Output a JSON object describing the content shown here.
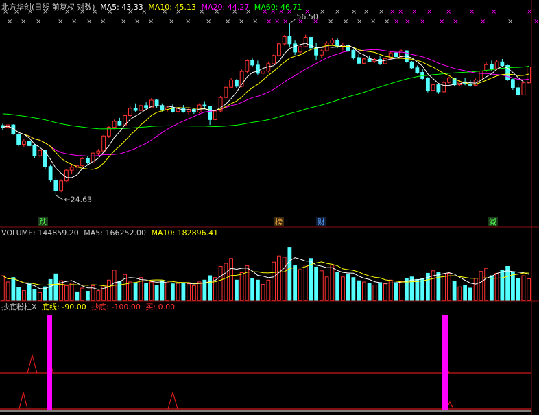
{
  "price_header": {
    "title": "北方华创(日线 前复权 对数)",
    "ma5": "MA5: 43.33",
    "ma10": "MA10: 45.13",
    "ma20": "MA20: 44.27",
    "ma60": "MA60: 46.71"
  },
  "volume_header": {
    "volume": "VOLUME: 144859.20",
    "ma5": "MA5: 166252.00",
    "ma10": "MA10: 182896.41"
  },
  "indicator_header": {
    "name": "抄底粉柱X",
    "bottom_line": "底线: -90.00",
    "chaodi": "抄底: -100.00",
    "buy": "买: 0.00"
  },
  "markers": {
    "low_label": "24.63",
    "high_label": "56.50",
    "tag_die": "跌",
    "tag_bang": "榜",
    "tag_cai": "财",
    "tag_jian": "減"
  },
  "colors": {
    "up": "#ff3232",
    "down": "#54ffff",
    "ma5": "#ffffff",
    "ma10": "#ffff00",
    "ma20": "#ff00ff",
    "ma60": "#00ff00",
    "pink_bar": "#ff00ff",
    "indicator_line": "#ff2020"
  },
  "chart_data": {
    "type": "candlestick",
    "ylim_log": [
      22.5,
      60
    ],
    "low_value": 24.63,
    "high_value": 56.5,
    "candles": [
      [
        34.5,
        34.8,
        33.8,
        34.2
      ],
      [
        34.2,
        34.9,
        33.9,
        34.6
      ],
      [
        34.6,
        34.7,
        33.0,
        33.1
      ],
      [
        33.1,
        33.5,
        31.2,
        31.5
      ],
      [
        31.5,
        32.3,
        31.1,
        32.0
      ],
      [
        32.0,
        32.4,
        31.0,
        31.3
      ],
      [
        31.3,
        31.6,
        29.5,
        29.8
      ],
      [
        29.8,
        30.8,
        29.6,
        30.6
      ],
      [
        30.6,
        30.7,
        28.0,
        28.3
      ],
      [
        28.3,
        28.6,
        26.2,
        26.5
      ],
      [
        26.5,
        26.9,
        24.63,
        25.2
      ],
      [
        25.2,
        26.6,
        25.0,
        26.4
      ],
      [
        26.4,
        28.0,
        26.2,
        27.8
      ],
      [
        27.8,
        28.5,
        27.3,
        28.2
      ],
      [
        28.2,
        28.6,
        27.7,
        28.4
      ],
      [
        28.4,
        29.6,
        28.2,
        29.4
      ],
      [
        29.4,
        29.8,
        28.5,
        28.8
      ],
      [
        28.8,
        30.5,
        28.6,
        30.2
      ],
      [
        30.2,
        30.8,
        29.9,
        30.5
      ],
      [
        30.5,
        33.0,
        30.3,
        32.8
      ],
      [
        32.8,
        34.5,
        32.5,
        34.2
      ],
      [
        34.2,
        35.5,
        33.9,
        35.2
      ],
      [
        35.2,
        35.8,
        34.4,
        34.6
      ],
      [
        34.6,
        36.4,
        34.5,
        36.2
      ],
      [
        36.2,
        37.8,
        36.0,
        37.5
      ],
      [
        37.5,
        38.4,
        36.8,
        37.1
      ],
      [
        37.1,
        38.2,
        36.9,
        38.0
      ],
      [
        38.0,
        38.6,
        37.3,
        37.6
      ],
      [
        37.6,
        39.4,
        37.5,
        39.0
      ],
      [
        39.0,
        39.2,
        37.6,
        38.0
      ],
      [
        38.0,
        38.4,
        36.9,
        37.2
      ],
      [
        37.2,
        37.9,
        36.9,
        37.6
      ],
      [
        37.6,
        38.2,
        36.7,
        36.9
      ],
      [
        36.9,
        37.7,
        36.5,
        37.5
      ],
      [
        37.5,
        38.1,
        36.7,
        36.9
      ],
      [
        36.9,
        37.5,
        36.4,
        37.3
      ],
      [
        37.3,
        37.6,
        36.5,
        36.8
      ],
      [
        36.8,
        38.4,
        36.6,
        38.1
      ],
      [
        38.1,
        38.8,
        37.6,
        37.9
      ],
      [
        37.9,
        37.9,
        34.6,
        35.5
      ],
      [
        35.5,
        37.3,
        35.4,
        37.0
      ],
      [
        37.0,
        39.8,
        36.8,
        39.5
      ],
      [
        39.5,
        41.8,
        39.3,
        41.5
      ],
      [
        41.5,
        43.4,
        41.3,
        43.0
      ],
      [
        43.0,
        43.2,
        41.4,
        41.7
      ],
      [
        41.7,
        45.2,
        41.5,
        44.8
      ],
      [
        44.8,
        47.5,
        44.5,
        47.2
      ],
      [
        47.2,
        47.7,
        45.8,
        46.2
      ],
      [
        46.2,
        47.2,
        44.0,
        44.4
      ],
      [
        44.4,
        45.3,
        43.6,
        44.9
      ],
      [
        44.9,
        47.0,
        44.6,
        46.5
      ],
      [
        46.5,
        48.8,
        46.3,
        48.4
      ],
      [
        48.4,
        51.5,
        48.2,
        51.2
      ],
      [
        51.2,
        53.4,
        50.8,
        53.0
      ],
      [
        53.0,
        56.5,
        50.3,
        51.2
      ],
      [
        51.2,
        52.0,
        48.5,
        49.2
      ],
      [
        49.2,
        51.0,
        48.9,
        50.5
      ],
      [
        50.5,
        53.5,
        50.3,
        52.8
      ],
      [
        52.8,
        53.2,
        49.8,
        50.2
      ],
      [
        50.2,
        51.4,
        47.3,
        48.5
      ],
      [
        48.5,
        50.0,
        47.8,
        49.5
      ],
      [
        49.5,
        51.8,
        49.3,
        51.4
      ],
      [
        51.4,
        52.7,
        50.8,
        52.1
      ],
      [
        52.1,
        52.6,
        50.2,
        50.6
      ],
      [
        50.6,
        51.4,
        49.6,
        50.9
      ],
      [
        50.9,
        51.3,
        49.2,
        49.6
      ],
      [
        49.6,
        50.0,
        47.5,
        47.9
      ],
      [
        47.9,
        48.6,
        46.3,
        46.6
      ],
      [
        46.6,
        47.9,
        46.4,
        47.6
      ],
      [
        47.6,
        48.4,
        46.8,
        47.0
      ],
      [
        47.0,
        47.9,
        46.7,
        47.5
      ],
      [
        47.5,
        48.3,
        46.2,
        46.5
      ],
      [
        46.5,
        47.9,
        46.3,
        47.7
      ],
      [
        47.7,
        49.3,
        47.5,
        49.0
      ],
      [
        49.0,
        49.6,
        47.7,
        48.1
      ],
      [
        48.1,
        49.8,
        47.9,
        49.5
      ],
      [
        49.5,
        49.6,
        46.7,
        46.9
      ],
      [
        46.9,
        47.1,
        45.3,
        45.6
      ],
      [
        45.6,
        46.1,
        44.3,
        44.6
      ],
      [
        44.6,
        45.3,
        43.0,
        43.3
      ],
      [
        43.3,
        43.6,
        40.5,
        40.9
      ],
      [
        40.9,
        42.2,
        40.7,
        42.0
      ],
      [
        42.0,
        42.3,
        40.2,
        40.6
      ],
      [
        40.6,
        42.8,
        40.4,
        42.5
      ],
      [
        42.5,
        43.7,
        42.3,
        43.4
      ],
      [
        43.4,
        43.5,
        41.7,
        42.0
      ],
      [
        42.0,
        43.0,
        41.8,
        42.6
      ],
      [
        42.6,
        43.4,
        41.9,
        42.2
      ],
      [
        42.2,
        43.0,
        41.6,
        41.9
      ],
      [
        41.9,
        43.3,
        41.7,
        43.0
      ],
      [
        43.0,
        45.2,
        42.8,
        44.9
      ],
      [
        44.9,
        46.8,
        44.7,
        46.3
      ],
      [
        46.3,
        47.2,
        44.9,
        45.4
      ],
      [
        45.4,
        47.3,
        45.1,
        46.9
      ],
      [
        46.9,
        47.6,
        45.8,
        46.1
      ],
      [
        46.1,
        46.3,
        42.8,
        43.1
      ],
      [
        43.1,
        43.3,
        41.0,
        41.4
      ],
      [
        41.4,
        42.3,
        39.6,
        40.0
      ],
      [
        40.0,
        42.7,
        39.9,
        42.4
      ],
      [
        42.4,
        46.1,
        42.2,
        45.8
      ]
    ],
    "volume": [
      [
        0.4,
        0
      ],
      [
        0.3,
        0
      ],
      [
        0.37,
        1
      ],
      [
        0.21,
        1
      ],
      [
        0.16,
        0
      ],
      [
        0.27,
        1
      ],
      [
        0.18,
        1
      ],
      [
        0.13,
        0
      ],
      [
        0.22,
        1
      ],
      [
        0.34,
        1
      ],
      [
        0.43,
        1
      ],
      [
        0.32,
        0
      ],
      [
        0.24,
        0
      ],
      [
        0.28,
        0
      ],
      [
        0.14,
        1
      ],
      [
        0.2,
        0
      ],
      [
        0.15,
        1
      ],
      [
        0.24,
        0
      ],
      [
        0.16,
        0
      ],
      [
        0.22,
        0
      ],
      [
        0.33,
        0
      ],
      [
        0.49,
        0
      ],
      [
        0.31,
        1
      ],
      [
        0.42,
        0
      ],
      [
        0.3,
        0
      ],
      [
        0.29,
        1
      ],
      [
        0.37,
        0
      ],
      [
        0.28,
        1
      ],
      [
        0.3,
        0
      ],
      [
        0.24,
        1
      ],
      [
        0.32,
        1
      ],
      [
        0.29,
        0
      ],
      [
        0.27,
        1
      ],
      [
        0.28,
        0
      ],
      [
        0.28,
        1
      ],
      [
        0.27,
        0
      ],
      [
        0.24,
        0
      ],
      [
        0.3,
        0
      ],
      [
        0.33,
        1
      ],
      [
        0.4,
        1
      ],
      [
        0.37,
        0
      ],
      [
        0.55,
        0
      ],
      [
        0.6,
        0
      ],
      [
        0.68,
        0
      ],
      [
        0.33,
        1
      ],
      [
        0.45,
        0
      ],
      [
        0.56,
        0
      ],
      [
        0.36,
        1
      ],
      [
        0.33,
        1
      ],
      [
        0.26,
        0
      ],
      [
        0.33,
        0
      ],
      [
        0.62,
        0
      ],
      [
        0.72,
        0
      ],
      [
        0.7,
        0
      ],
      [
        0.86,
        1
      ],
      [
        0.56,
        1
      ],
      [
        0.5,
        0
      ],
      [
        0.57,
        0
      ],
      [
        0.68,
        1
      ],
      [
        0.54,
        1
      ],
      [
        0.48,
        0
      ],
      [
        0.38,
        0
      ],
      [
        0.57,
        0
      ],
      [
        0.46,
        1
      ],
      [
        0.38,
        0
      ],
      [
        0.43,
        1
      ],
      [
        0.37,
        1
      ],
      [
        0.32,
        1
      ],
      [
        0.3,
        0
      ],
      [
        0.28,
        1
      ],
      [
        0.25,
        0
      ],
      [
        0.29,
        1
      ],
      [
        0.27,
        0
      ],
      [
        0.33,
        0
      ],
      [
        0.29,
        1
      ],
      [
        0.31,
        0
      ],
      [
        0.35,
        1
      ],
      [
        0.38,
        1
      ],
      [
        0.34,
        1
      ],
      [
        0.36,
        1
      ],
      [
        0.44,
        1
      ],
      [
        0.48,
        0
      ],
      [
        0.46,
        1
      ],
      [
        0.43,
        0
      ],
      [
        0.44,
        0
      ],
      [
        0.31,
        1
      ],
      [
        0.22,
        0
      ],
      [
        0.24,
        1
      ],
      [
        0.2,
        1
      ],
      [
        0.36,
        0
      ],
      [
        0.47,
        0
      ],
      [
        0.52,
        0
      ],
      [
        0.4,
        1
      ],
      [
        0.44,
        0
      ],
      [
        0.49,
        1
      ],
      [
        0.55,
        1
      ],
      [
        0.46,
        1
      ],
      [
        0.35,
        1
      ],
      [
        0.4,
        0
      ],
      [
        0.35,
        0
      ]
    ],
    "pink_bars": [
      10,
      95
    ],
    "bottom_line": -90,
    "chaodi": -100,
    "buy": 0
  }
}
